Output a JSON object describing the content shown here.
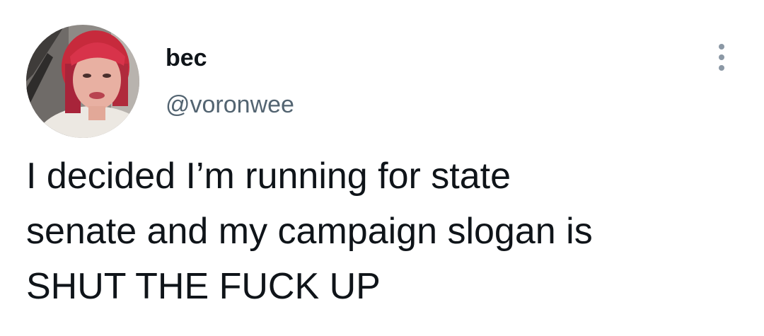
{
  "tweet": {
    "author": {
      "display_name": "bec",
      "handle": "@voronwee",
      "avatar_icon": "profile-photo"
    },
    "more_icon": "more-options-icon",
    "text": "I decided I’m running for state\nsenate and my campaign slogan is\nSHUT THE FUCK UP"
  },
  "colors": {
    "text_primary": "#0f1419",
    "text_secondary": "#536471",
    "more_dots": "#8b98a5",
    "background": "#ffffff"
  }
}
